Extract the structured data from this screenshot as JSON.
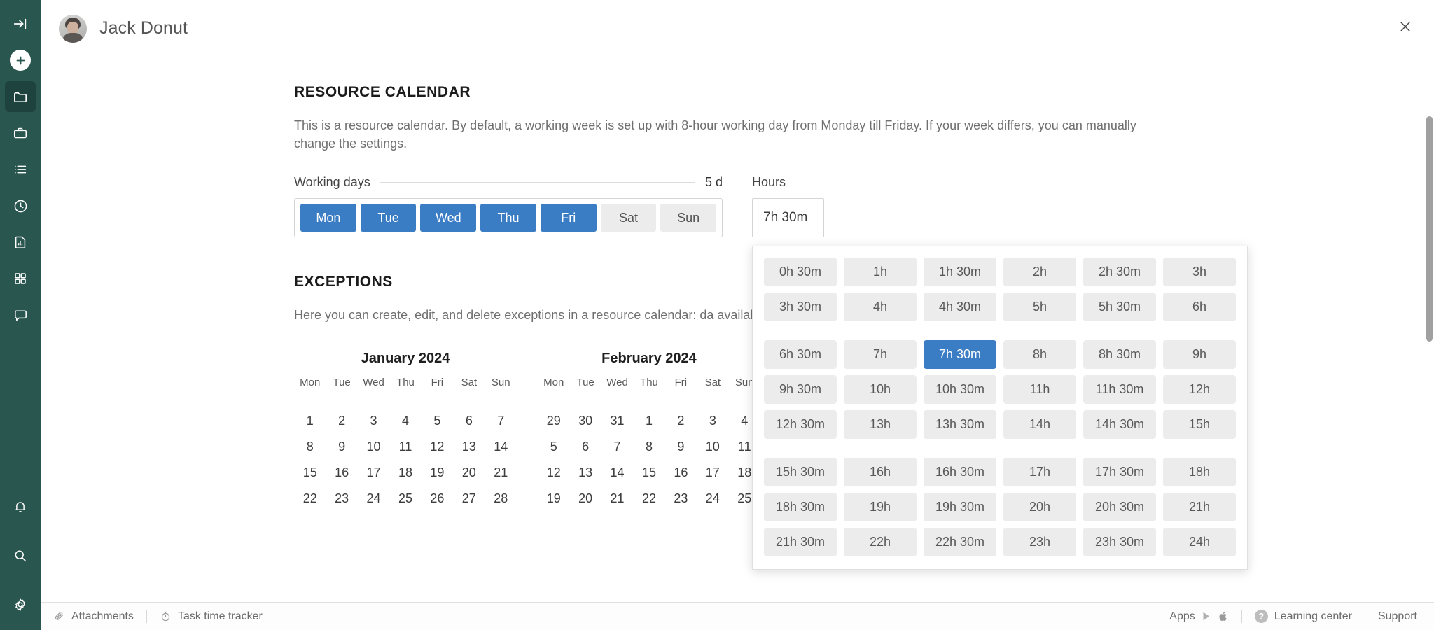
{
  "sidebar": {
    "items": [
      {
        "name": "collapse-panel",
        "icon": "arrow-to-line-icon"
      },
      {
        "name": "add",
        "icon": "plus-circle-icon"
      },
      {
        "name": "projects",
        "icon": "folder-icon",
        "active": true
      },
      {
        "name": "portfolio",
        "icon": "briefcase-icon"
      },
      {
        "name": "tasks-list",
        "icon": "list-icon"
      },
      {
        "name": "time",
        "icon": "clock-icon"
      },
      {
        "name": "reports",
        "icon": "report-document-icon"
      },
      {
        "name": "apps-grid",
        "icon": "grid-icon"
      },
      {
        "name": "messages",
        "icon": "chat-bubble-icon"
      }
    ],
    "bottom_items": [
      {
        "name": "notifications",
        "icon": "bell-icon"
      },
      {
        "name": "search",
        "icon": "search-icon"
      },
      {
        "name": "settings",
        "icon": "gear-icon"
      }
    ]
  },
  "header": {
    "title": "Jack Donut",
    "close_label": "×"
  },
  "resource_calendar": {
    "title": "RESOURCE CALENDAR",
    "description": "This is a resource calendar. By default, a working week is set up with 8-hour working day from Monday till Friday. If your week differs, you can manually change the settings.",
    "working_days_label": "Working days",
    "working_days_count": "5 d",
    "days": [
      {
        "label": "Mon",
        "selected": true
      },
      {
        "label": "Tue",
        "selected": true
      },
      {
        "label": "Wed",
        "selected": true
      },
      {
        "label": "Thu",
        "selected": true
      },
      {
        "label": "Fri",
        "selected": true
      },
      {
        "label": "Sat",
        "selected": false
      },
      {
        "label": "Sun",
        "selected": false
      }
    ],
    "hours_label": "Hours",
    "hours_value": "7h 30m",
    "hours_options": [
      "0h 30m",
      "1h",
      "1h 30m",
      "2h",
      "2h 30m",
      "3h",
      "3h 30m",
      "4h",
      "4h 30m",
      "5h",
      "5h 30m",
      "6h",
      "6h 30m",
      "7h",
      "7h 30m",
      "8h",
      "8h 30m",
      "9h",
      "9h 30m",
      "10h",
      "10h 30m",
      "11h",
      "11h 30m",
      "12h",
      "12h 30m",
      "13h",
      "13h 30m",
      "14h",
      "14h 30m",
      "15h",
      "15h 30m",
      "16h",
      "16h 30m",
      "17h",
      "17h 30m",
      "18h",
      "18h 30m",
      "19h",
      "19h 30m",
      "20h",
      "20h 30m",
      "21h",
      "21h 30m",
      "22h",
      "22h 30m",
      "23h",
      "23h 30m",
      "24h"
    ],
    "hours_selected": "7h 30m"
  },
  "exceptions": {
    "title": "EXCEPTIONS",
    "description": "Here you can create, edit, and delete exceptions in a resource calendar: da availability in resources workload.",
    "weekday_headers": [
      "Mon",
      "Tue",
      "Wed",
      "Thu",
      "Fri",
      "Sat",
      "Sun"
    ],
    "calendars": [
      {
        "title": "January 2024",
        "weeks": [
          [
            {
              "d": "1"
            },
            {
              "d": "2"
            },
            {
              "d": "3"
            },
            {
              "d": "4"
            },
            {
              "d": "5"
            },
            {
              "d": "6",
              "wknd": true
            },
            {
              "d": "7",
              "wknd": true
            }
          ],
          [
            {
              "d": "8"
            },
            {
              "d": "9"
            },
            {
              "d": "10"
            },
            {
              "d": "11"
            },
            {
              "d": "12"
            },
            {
              "d": "13",
              "wknd": true
            },
            {
              "d": "14",
              "wknd": true
            }
          ],
          [
            {
              "d": "15"
            },
            {
              "d": "16"
            },
            {
              "d": "17"
            },
            {
              "d": "18"
            },
            {
              "d": "19"
            },
            {
              "d": "20",
              "wknd": true
            },
            {
              "d": "21",
              "wknd": true
            }
          ],
          [
            {
              "d": "22"
            },
            {
              "d": "23"
            },
            {
              "d": "24"
            },
            {
              "d": "25"
            },
            {
              "d": "26"
            },
            {
              "d": "27",
              "wknd": true
            },
            {
              "d": "28",
              "wknd": true
            }
          ]
        ]
      },
      {
        "title": "February 2024",
        "weeks": [
          [
            {
              "d": "29",
              "out": true
            },
            {
              "d": "30",
              "out": true
            },
            {
              "d": "31",
              "out": true
            },
            {
              "d": "1"
            },
            {
              "d": "2"
            },
            {
              "d": "3",
              "wknd": true
            },
            {
              "d": "4",
              "wknd": true
            }
          ],
          [
            {
              "d": "5"
            },
            {
              "d": "6"
            },
            {
              "d": "7"
            },
            {
              "d": "8"
            },
            {
              "d": "9"
            },
            {
              "d": "10",
              "wknd": true
            },
            {
              "d": "11",
              "wknd": true
            }
          ],
          [
            {
              "d": "12"
            },
            {
              "d": "13"
            },
            {
              "d": "14"
            },
            {
              "d": "15"
            },
            {
              "d": "16"
            },
            {
              "d": "17",
              "wknd": true
            },
            {
              "d": "18",
              "wknd": true
            }
          ],
          [
            {
              "d": "19"
            },
            {
              "d": "20"
            },
            {
              "d": "21"
            },
            {
              "d": "22"
            },
            {
              "d": "23"
            },
            {
              "d": "24",
              "wknd": true
            },
            {
              "d": "25",
              "wknd": true
            }
          ]
        ]
      }
    ]
  },
  "footer": {
    "attachments_label": "Attachments",
    "task_time_tracker_label": "Task time tracker",
    "apps_label": "Apps",
    "learning_center_label": "Learning center",
    "support_label": "Support"
  },
  "colors": {
    "sidebar_bg": "#2a5650",
    "sidebar_active": "#1e433e",
    "accent_blue": "#3b7dc4",
    "weekend_blue": "#3d7ddb",
    "chip_bg": "#ececec"
  }
}
